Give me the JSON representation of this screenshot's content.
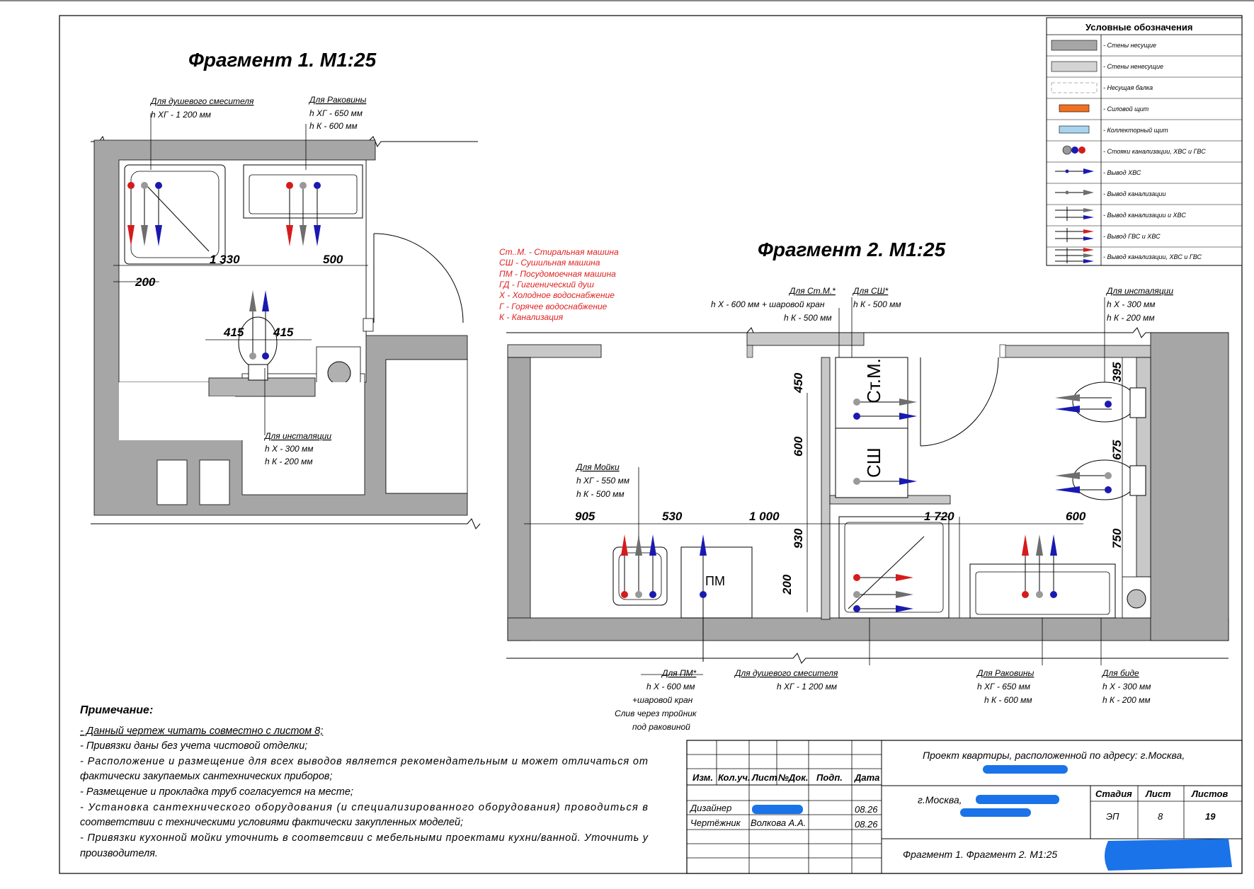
{
  "fragment1": {
    "title": "Фрагмент 1. М1:25",
    "shower_title": "Для душевого смесителя",
    "shower_h": "h ХГ - 1 200 мм",
    "sink_title": "Для Раковины",
    "sink_h1": "h ХГ - 650 мм",
    "sink_h2": "h К - 600 мм",
    "install_title": "Для инсталяции",
    "install_h1": "h Х - 300 мм",
    "install_h2": "h К - 200 мм",
    "dims": {
      "d1330": "1 330",
      "d500": "500",
      "d200": "200",
      "d415a": "415",
      "d415b": "415"
    }
  },
  "abbreviations": [
    "Ст..М. - Стиральная машина",
    "СШ - Сушильная машина",
    "ПМ - Посудомоечная машина",
    "ГД - Гигиенический душ",
    "Х - Холодное водоснабжение",
    "Г - Горячее водоснабжение",
    "К - Канализация"
  ],
  "fragment2": {
    "title": "Фрагмент 2. М1:25",
    "washer_title": "Для Ст.М.*",
    "washer_h1": "h Х - 600 мм + шаровой кран",
    "washer_h2": "h К - 500 мм",
    "dryer_title": "Для СШ*",
    "dryer_h1": "h К - 500 мм",
    "install_title": "Для инсталяции",
    "install_h1": "h Х - 300 мм",
    "install_h2": "h К - 200 мм",
    "kitchen_title": "Для Мойки",
    "kitchen_h1": "h ХГ - 550 мм",
    "kitchen_h2": "h К - 500 мм",
    "dw_title": "Для ПМ*",
    "dw_h1": "h Х - 600 мм",
    "dw_h2": "+шаровой кран",
    "dw_h3": "Слив через тройник",
    "dw_h4": "под раковиной",
    "shower_title": "Для душевого смесителя",
    "shower_h": "h ХГ - 1 200 мм",
    "sink_title": "Для Раковины",
    "sink_h1": "h ХГ - 650 мм",
    "sink_h2": "h К - 600 мм",
    "bidet_title": "Для биде",
    "bidet_h1": "h Х - 300 мм",
    "bidet_h2": "h К - 200 мм",
    "label_stm": "Ст.М.",
    "label_sh": "СШ",
    "label_pm": "ПМ",
    "dims": {
      "d905": "905",
      "d530": "530",
      "d1000": "1 000",
      "d1720": "1 720",
      "d600h": "600",
      "d450": "450",
      "d600v": "600",
      "d930": "930",
      "d200": "200",
      "d395": "395",
      "d675": "675",
      "d750": "750"
    }
  },
  "legend": {
    "title": "Условные обозначения",
    "items": [
      "- Стены несущие",
      "- Стены ненесущие",
      "- Несущая балка",
      "- Силовой щит",
      "- Коллекторный щит",
      "- Стояки канализации, ХВС и ГВС",
      "- Вывод ХВС",
      "- Вывод канализации",
      "- Вывод канализации и ХВС",
      "- Вывод ГВС и ХВС",
      "- Вывод канализации, ХВС и ГВС"
    ]
  },
  "notes": {
    "title": "Примечание:",
    "lines": [
      "- Данный чертеж читать совместно с листом 8;",
      "- Привязки даны без учета чистовой отделки;",
      "- Расположение и размещение для всех выводов является рекомендательным и может отличаться от",
      "фактически закупаемых сантехнических приборов;",
      "- Размещение и прокладка труб согласуется на месте;",
      "- Установка сантехнического оборудования (и специализированного оборудования) проводиться в",
      "соответствии с техническими условиями фактически закупленных моделей;",
      "- Привязки кухонной мойки уточнить в соответсвии с мебельными проектами кухни/ванной. Уточнить у",
      "производителя."
    ]
  },
  "title_block": {
    "col_izm": "Изм.",
    "col_koluch": "Кол.уч.",
    "col_list": "Лист",
    "col_ndok": "№Док.",
    "col_podp": "Подп.",
    "col_data": "Дата",
    "row1_role": "Дизайнер",
    "row1_date": "08.26",
    "row2_role": "Чертёжник",
    "row2_name": "Волкова А.А.",
    "row2_date": "08.26",
    "project": "Проект квартиры, расположенной по адресу: г.Москва,",
    "city": "г.Москва,",
    "stage_h": "Стадия",
    "sheet_h": "Лист",
    "sheets_h": "Листов",
    "stage": "ЭП",
    "sheet": "8",
    "sheets": "19",
    "drawing_name": "Фрагмент 1. Фрагмент 2. М1:25"
  },
  "colors": {
    "wall_bearing": "#a6a6a6",
    "wall_light": "#d4d4d4",
    "cold": "#1a1ab0",
    "hot": "#d41c1c",
    "sewer": "#6e6e6e",
    "redacted": "#1a73e8"
  }
}
